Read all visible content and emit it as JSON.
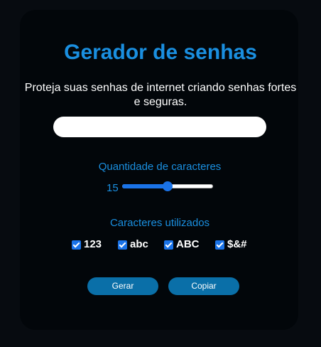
{
  "header": {
    "title": "Gerador de senhas",
    "subtitle": "Proteja suas senhas de internet criando senhas fortes e seguras."
  },
  "password": {
    "value": "",
    "placeholder": ""
  },
  "length": {
    "label": "Quantidade de caracteres",
    "value": "15",
    "slider_fraction": 0.5
  },
  "characters": {
    "label": "Caracteres utilizados",
    "options": [
      {
        "label": "123",
        "checked": true
      },
      {
        "label": "abc",
        "checked": true
      },
      {
        "label": "ABC",
        "checked": true
      },
      {
        "label": "$&#",
        "checked": true
      }
    ]
  },
  "actions": {
    "generate_label": "Gerar",
    "copy_label": "Copiar"
  },
  "colors": {
    "accent": "#1a8fe0",
    "button": "#0a6fa8",
    "checkbox": "#1a73e8",
    "background": "#02060a"
  }
}
